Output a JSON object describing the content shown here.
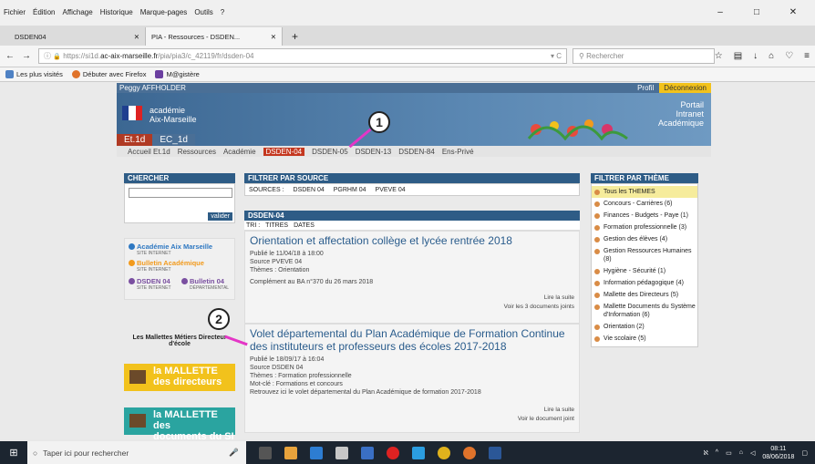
{
  "menu": [
    "Fichier",
    "Édition",
    "Affichage",
    "Historique",
    "Marque-pages",
    "Outils",
    "?"
  ],
  "window_controls": [
    "–",
    "□",
    "✕"
  ],
  "tabs": [
    {
      "label": "DSDEN04",
      "close": "✕"
    },
    {
      "label": "PIA - Ressources - DSDEN...",
      "close": "✕"
    }
  ],
  "newtab": "+",
  "nav": {
    "back": "←",
    "forward": "→",
    "info": "ⓘ",
    "lock": "🔒",
    "url_pre": "https://si1d.",
    "url_domain": "ac-aix-marseille.fr",
    "url_post": "/pia/pia3/c_42119/fr/dsden-04",
    "url_right": "▾  C",
    "search_placeholder": "Rechercher",
    "icons": [
      "☆",
      "▤",
      "↓",
      "⌂",
      "♡",
      "≡"
    ]
  },
  "bookmarks": [
    "Les plus visités",
    "Débuter avec Firefox",
    "M@gistère"
  ],
  "topstrip": {
    "user": "Peggy AFFHOLDER",
    "profil": "Profil",
    "deconnexion": "Déconnexion"
  },
  "banner": {
    "academie_l1": "académie",
    "academie_l2": "Aix-Marseille",
    "portail_l1": "Portail",
    "portail_l2": "Intranet",
    "portail_l3": "Académique",
    "tabs": [
      "Et.1d",
      "EC_1d"
    ]
  },
  "navstrip": [
    "Accueil Et.1d",
    "Ressources",
    "Académie",
    "DSDEN-04",
    "DSDEN-05",
    "DSDEN-13",
    "DSDEN-84",
    "Ens-Privé"
  ],
  "chercher": {
    "title": "CHERCHER",
    "valider": "valider"
  },
  "links": [
    {
      "title": "Académie Aix Marseille",
      "sub": "SITE INTERNET"
    },
    {
      "title": "Bulletin Académique",
      "sub": "SITE INTERNET"
    },
    {
      "title": "DSDEN 04",
      "sub": "SITE INTERNET"
    },
    {
      "title": "Bulletin 04",
      "sub": "DÉPARTEMENTAL"
    }
  ],
  "mallettes": {
    "heading": "Les Mallettes Métiers Directeur d'école",
    "m1_l1": "la MALLETTE",
    "m1_l2": "des directeurs",
    "m2_l1": "la MALLETTE des",
    "m2_l2": "documents du SI"
  },
  "filtre_source": {
    "title": "FILTRER PAR SOURCE",
    "label": "SOURCES :",
    "items": [
      "DSDEN 04",
      "PGRHM 04",
      "PVEVE 04"
    ]
  },
  "dsden": {
    "title": "DSDEN-04",
    "tri": "TRI :",
    "tri_items": [
      "TITRES",
      "DATES"
    ]
  },
  "articles": [
    {
      "title": "Orientation et affectation collège et lycée rentrée 2018",
      "publie": "Publié le 11/04/18 à 18:00",
      "source": "Source PVEVE 04",
      "themes": "Thèmes   :  Orientation",
      "complement": "Complément au BA n°370 du 26 mars 2018",
      "lire": "Lire la suite",
      "voir": "Voir les 3 documents joints"
    },
    {
      "title": "Volet départemental du Plan Académique de Formation Continue des instituteurs et professeurs des écoles 2017-2018",
      "publie": "Publié le 18/09/17 à 16:04",
      "source": "Source DSDEN 04",
      "themes": "Thèmes   :  Formation professionnelle",
      "motcle": "Mot-clé   :  Formations et concours",
      "complement": "Retrouvez ici le volet départemental du Plan Académique de formation 2017-2018",
      "lire": "Lire la suite",
      "voir": "Voir le document joint"
    }
  ],
  "themes": {
    "title": "FILTRER PAR THÈME",
    "items": [
      "Tous les THEMES",
      "Concours - Carrières (6)",
      "Finances - Budgets - Paye (1)",
      "Formation professionnelle (3)",
      "Gestion des élèves (4)",
      "Gestion Ressources Humaines (8)",
      "Hygiène - Sécurité (1)",
      "Information pédagogique (4)",
      "Mallette des Directeurs (5)",
      "Mallette Documents du Système d'Information (6)",
      "Orientation (2)",
      "Vie scolaire (5)"
    ]
  },
  "markers": [
    "1",
    "2"
  ],
  "taskbar": {
    "search": "Taper ici pour rechercher",
    "time": "08:11",
    "date": "08/06/2018"
  },
  "colors": {
    "accent": "#2e5c86",
    "selected_tab": "#c4371f",
    "marker_arrow": "#e436c6",
    "highlight": "#f2c21c"
  }
}
